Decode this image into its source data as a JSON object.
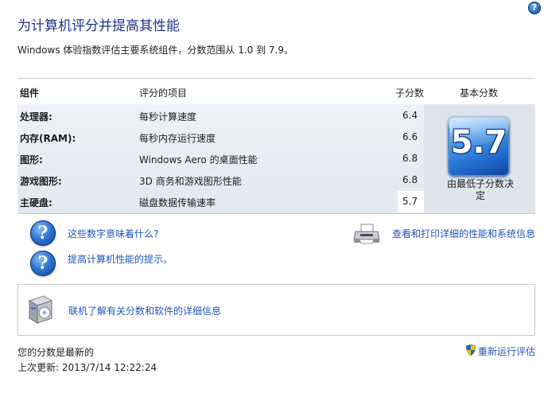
{
  "help": {
    "label": "?"
  },
  "header": {
    "title": "为计算机评分并提高其性能",
    "subtitle": "Windows 体验指数评估主要系统组件，分数范围从 1.0 到 7.9。"
  },
  "table": {
    "headers": {
      "component": "组件",
      "rated": "评分的项目",
      "subscore": "子分数",
      "base": "基本分数"
    },
    "rows": [
      {
        "component": "处理器:",
        "item": "每秒计算速度",
        "score": "6.4"
      },
      {
        "component": "内存(RAM):",
        "item": "每秒内存运行速度",
        "score": "6.6"
      },
      {
        "component": "图形:",
        "item": "Windows Aero 的桌面性能",
        "score": "6.8"
      },
      {
        "component": "游戏图形:",
        "item": "3D 商务和游戏图形性能",
        "score": "6.8"
      },
      {
        "component": "主硬盘:",
        "item": "磁盘数据传输速率",
        "score": "5.7"
      }
    ],
    "base_score": "5.7",
    "base_caption": "由最低子分数决定"
  },
  "links": {
    "what_numbers": "这些数字意味着什么?",
    "tips": "提高计算机性能的提示。",
    "print_details": "查看和打印详细的性能和系统信息",
    "online_info": "联机了解有关分数和软件的详细信息"
  },
  "status": {
    "current": "您的分数是最新的",
    "last_update": "上次更新: 2013/7/14 12:22:24",
    "rerun": "重新运行评估"
  },
  "colors": {
    "title": "#1e3287",
    "link": "#1f56b8",
    "badge": "#1d63c8"
  },
  "icons": [
    "help-icon",
    "question-icon",
    "printer-icon",
    "software-box-icon",
    "uac-shield-icon"
  ]
}
